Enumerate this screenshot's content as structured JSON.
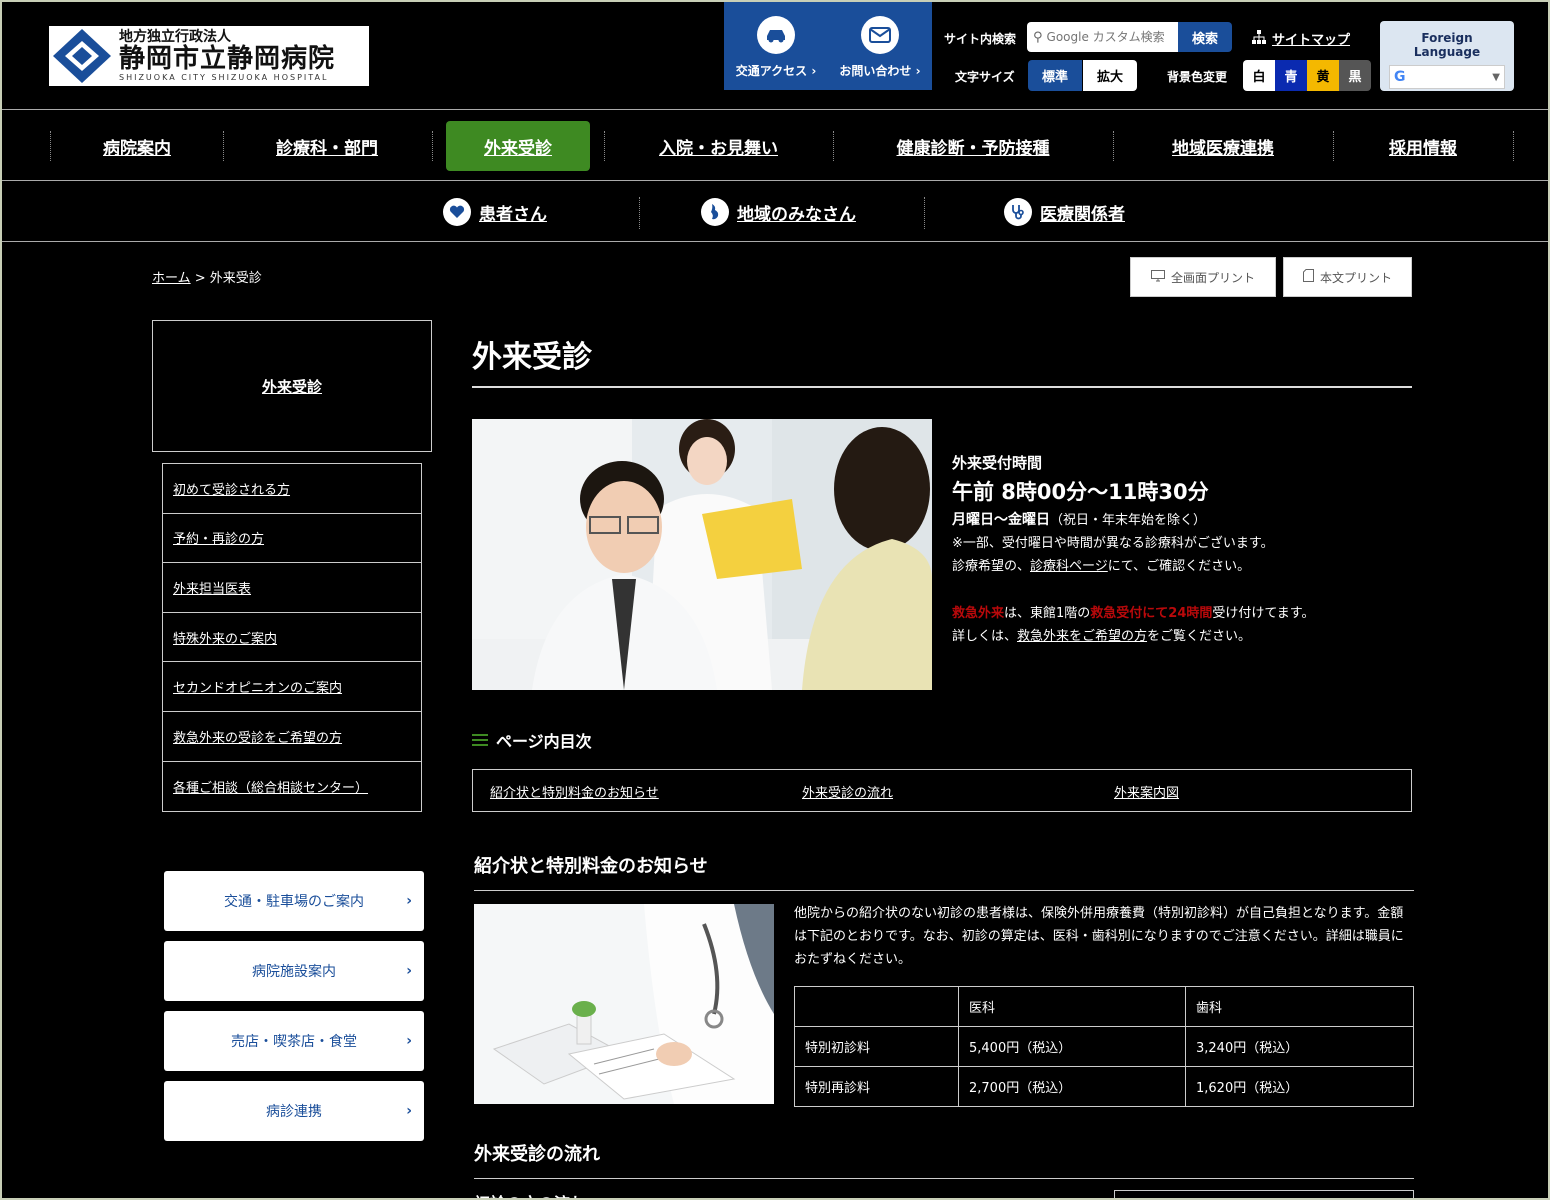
{
  "header": {
    "logo_small": "地方独立行政法人",
    "logo_main": "静岡市立静岡病院",
    "logo_en": "SHIZUOKA CITY SHIZUOKA HOSPITAL",
    "access_label": "交通アクセス",
    "contact_label": "お問い合わせ",
    "search_label": "サイト内検索",
    "search_placeholder": "Google カスタム検索",
    "search_button": "検索",
    "sitemap_label": "サイトマップ",
    "fontsize_label": "文字サイズ",
    "fontsize_standard": "標準",
    "fontsize_large": "拡大",
    "bgcolor_label": "背景色変更",
    "bg_white": "白",
    "bg_blue": "青",
    "bg_yellow": "黄",
    "bg_black": "黒",
    "foreign_title": "Foreign Language"
  },
  "gnav": [
    "病院案内",
    "診療科・部門",
    "外来受診",
    "入院・お見舞い",
    "健康診断・予防接種",
    "地域医療連携",
    "採用情報"
  ],
  "anav": [
    "患者さん",
    "地域のみなさん",
    "医療関係者"
  ],
  "breadcrumb": {
    "home": "ホーム",
    "sep": " > ",
    "current": "外来受診"
  },
  "print": {
    "full": "全画面プリント",
    "text": "本文プリント"
  },
  "sidebar": {
    "title": "外来受診",
    "items": [
      "初めて受診される方",
      "予約・再診の方",
      "外来担当医表",
      "特殊外来のご案内",
      "セカンドオピニオンのご案内",
      "救急外来の受診をご希望の方",
      "各種ご相談（総合相談センター）"
    ],
    "buttons": [
      "交通・駐車場のご案内",
      "病院施設案内",
      "売店・喫茶店・食堂",
      "病診連携"
    ]
  },
  "main": {
    "title": "外来受診",
    "hours_head": "外来受付時間",
    "hours_time": "午前 8時00分～11時30分",
    "hours_days": "月曜日～金曜日",
    "hours_days_note": "（祝日・年末年始を除く）",
    "hours_note1": "※一部、受付曜日や時間が異なる診療科がございます。",
    "hours_note2_pre": "診療希望の、",
    "hours_note2_link": "診療科ページ",
    "hours_note2_post": "にて、ご確認ください。",
    "er_label": "救急外来",
    "er_mid": "は、東館1階の",
    "er_red2": "救急受付にて24時間",
    "er_post": "受け付けてます。",
    "er2_pre": "詳しくは、",
    "er2_link": "救急外来をご希望の方",
    "er2_post": "をご覧ください。",
    "toc_head": "ページ内目次",
    "toc": [
      "紹介状と特別料金のお知らせ",
      "外来受診の流れ",
      "外来案内図"
    ],
    "sec1_title": "紹介状と特別料金のお知らせ",
    "sec1_text": "他院からの紹介状のない初診の患者様は、保険外併用療養費（特別初診料）が自己負担となります。金額は下記のとおりです。なお、初診の算定は、医科・歯科別になりますのでご注意ください。詳細は職員におたずねください。",
    "fee_table": {
      "headers": [
        "",
        "医科",
        "歯科"
      ],
      "rows": [
        [
          "特別初診料",
          "5,400円（税込）",
          "3,240円（税込）"
        ],
        [
          "特別再診料",
          "2,700円（税込）",
          "1,620円（税込）"
        ]
      ]
    },
    "sec2_title": "外来受診の流れ",
    "sec2_sub": "初診の方の流れ"
  },
  "colors": {
    "accent_green": "#3e8a22",
    "brand_blue": "#1a4e9a",
    "alert_red": "#b9090b"
  }
}
